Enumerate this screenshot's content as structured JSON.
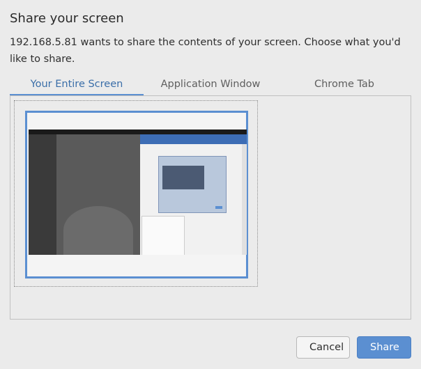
{
  "dialog": {
    "title": "Share your screen",
    "message": "192.168.5.81 wants to share the contents of your screen. Choose what you'd like to share."
  },
  "tabs": [
    {
      "label": "Your Entire Screen",
      "active": true
    },
    {
      "label": "Application Window",
      "active": false
    },
    {
      "label": "Chrome Tab",
      "active": false
    }
  ],
  "buttons": {
    "cancel_label": "Cancel",
    "share_label": "Share"
  },
  "colors": {
    "accent": "#5b8fd1",
    "active_tab_text": "#3a6ea8",
    "background": "#ebebeb"
  }
}
